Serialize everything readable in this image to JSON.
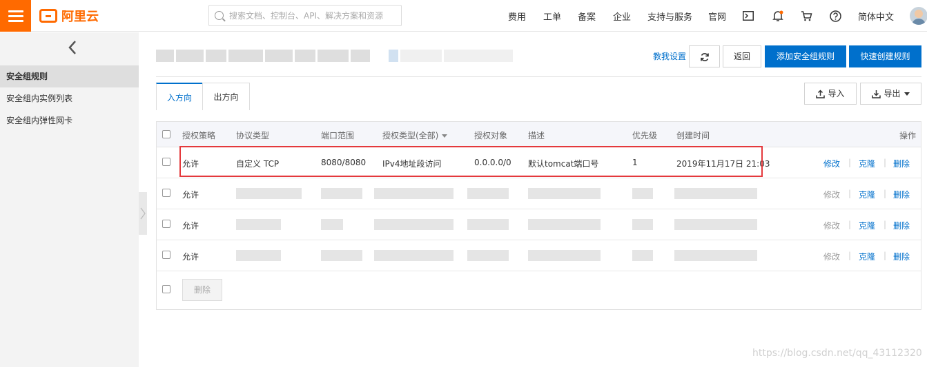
{
  "topbar": {
    "logo_text": "阿里云",
    "search_placeholder": "搜索文档、控制台、API、解决方案和资源",
    "nav": [
      "费用",
      "工单",
      "备案",
      "企业",
      "支持与服务",
      "官网"
    ],
    "lang": "简体中文"
  },
  "sidebar": {
    "items": [
      {
        "label": "安全组规则",
        "active": true
      },
      {
        "label": "安全组内实例列表",
        "active": false
      },
      {
        "label": "安全组内弹性网卡",
        "active": false
      }
    ]
  },
  "header": {
    "teach_link": "教我设置",
    "back_label": "返回",
    "add_rule_label": "添加安全组规则",
    "quick_create_label": "快速创建规则"
  },
  "tabs": [
    "入方向",
    "出方向"
  ],
  "toolbar": {
    "import_label": "导入",
    "export_label": "导出"
  },
  "table": {
    "columns": [
      "授权策略",
      "协议类型",
      "端口范围",
      "授权类型(全部)",
      "授权对象",
      "描述",
      "优先级",
      "创建时间",
      "操作"
    ],
    "rows": [
      {
        "policy": "允许",
        "protocol": "自定义 TCP",
        "port": "8080/8080",
        "auth_type": "IPv4地址段访问",
        "auth_object": "0.0.0.0/0",
        "description": "默认tomcat端口号",
        "priority": "1",
        "created": "2019年11月17日 21:03",
        "edit": "修改",
        "clone": "克隆",
        "delete": "删除",
        "edit_enabled": true
      },
      {
        "policy": "允许",
        "edit": "修改",
        "clone": "克隆",
        "delete": "删除",
        "edit_enabled": false
      },
      {
        "policy": "允许",
        "edit": "修改",
        "clone": "克隆",
        "delete": "删除",
        "edit_enabled": false
      },
      {
        "policy": "允许",
        "edit": "修改",
        "clone": "克隆",
        "delete": "删除",
        "edit_enabled": false
      }
    ],
    "bulk_delete_label": "删除"
  },
  "watermark": "https://blog.csdn.net/qq_43112320",
  "colors": {
    "brand": "#ff6a00",
    "primary": "#0070cc",
    "highlight": "#e4393c"
  }
}
